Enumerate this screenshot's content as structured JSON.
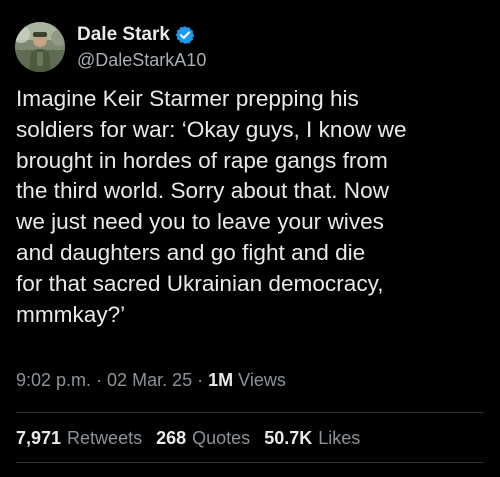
{
  "author": {
    "display_name": "Dale Stark",
    "handle": "@DaleStarkA10",
    "verified_color": "#1d9bf0"
  },
  "tweet": {
    "text": "Imagine Keir Starmer prepping his\nsoldiers for war: ‘Okay guys, I know we\nbrought in hordes of rape gangs from\nthe third world. Sorry about that.  Now\nwe just need you to leave your wives\nand daughters and go fight and die\nfor that sacred Ukrainian democracy,\nmmmkay?’"
  },
  "meta": {
    "time": "9:02 p.m.",
    "separator": "·",
    "date": "02 Mar. 25",
    "views_count": "1M",
    "views_label": "Views"
  },
  "stats": {
    "retweets_count": "7,971",
    "retweets_label": "Retweets",
    "quotes_count": "268",
    "quotes_label": "Quotes",
    "likes_count": "50.7K",
    "likes_label": "Likes"
  },
  "icons": {
    "avatar": "profile-avatar",
    "verified": "verified-badge-icon"
  }
}
